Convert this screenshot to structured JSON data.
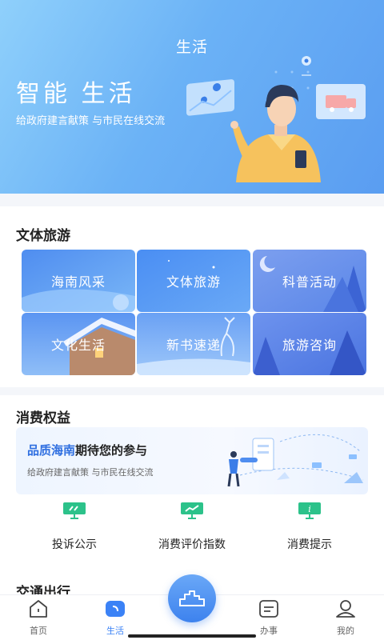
{
  "header": {
    "title": "生活",
    "slogan": "智能 生活",
    "subslogan": "给政府建言献策 与市民在线交流"
  },
  "culture": {
    "title": "文体旅游",
    "tiles": [
      {
        "label": "海南风采"
      },
      {
        "label": "文体旅游"
      },
      {
        "label": "科普活动"
      },
      {
        "label": "文化生活"
      },
      {
        "label": "新书速递"
      },
      {
        "label": "旅游咨询"
      }
    ]
  },
  "consumer": {
    "title": "消费权益",
    "banner": {
      "highlight": "品质海南",
      "rest": "期待您的参与",
      "subtitle": "给政府建言献策 与市民在线交流"
    },
    "actions": [
      {
        "label": "投诉公示",
        "icon": "complaint-board-icon"
      },
      {
        "label": "消费评价指数",
        "icon": "trend-chart-icon"
      },
      {
        "label": "消费提示",
        "icon": "info-board-icon"
      }
    ]
  },
  "traffic": {
    "title": "交通出行"
  },
  "tabbar": {
    "items": [
      {
        "label": "首页",
        "icon": "home-icon"
      },
      {
        "label": "生活",
        "icon": "life-icon",
        "active": true
      },
      {
        "label": "",
        "icon": "city-icon"
      },
      {
        "label": "办事",
        "icon": "service-icon"
      },
      {
        "label": "我的",
        "icon": "profile-icon"
      }
    ]
  },
  "colors": {
    "accent": "#3b82f6",
    "highlight": "#2f6fe0",
    "icon_green": "#2cc28a"
  }
}
